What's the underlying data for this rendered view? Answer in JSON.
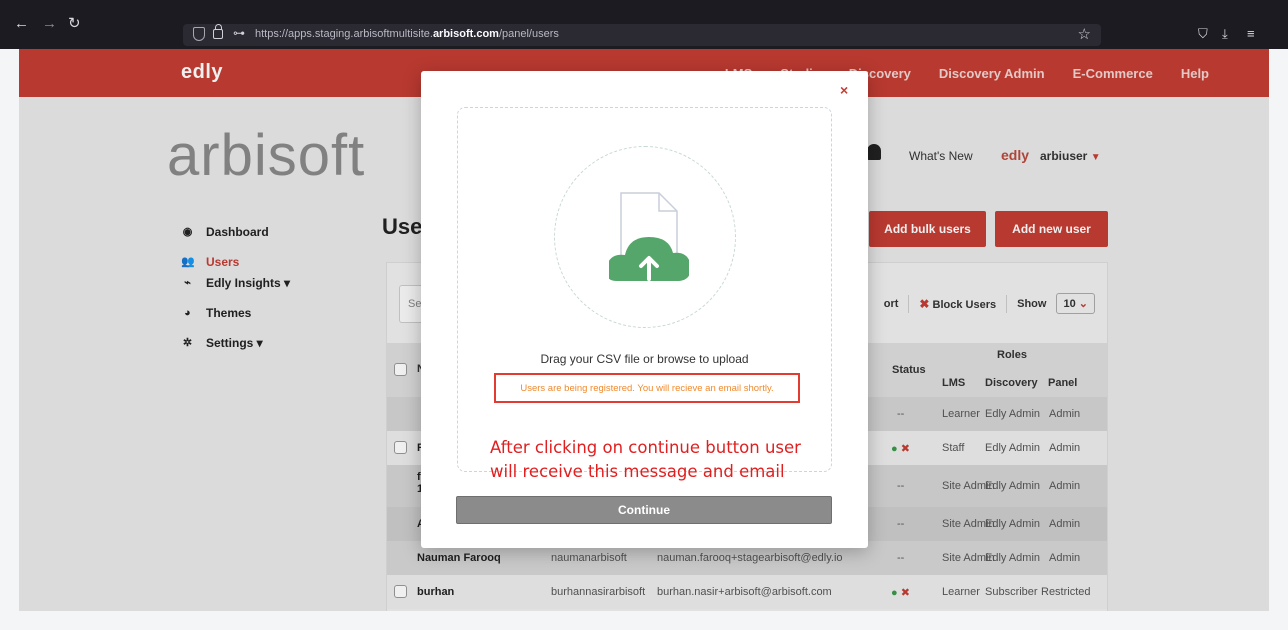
{
  "browser": {
    "back": "←",
    "forward": "→",
    "reload": "↻",
    "url_prefix": "https://apps.staging.arbisoftmultisite.",
    "url_host": "arbisoft.com",
    "url_path": "/panel/users",
    "star_icon": "star-icon",
    "pocket": "⛉",
    "download": "⤓",
    "menu": "≡"
  },
  "topnav": {
    "logo": "edly",
    "links": [
      "LMS",
      "Studio",
      "Discovery",
      "Discovery Admin",
      "E-Commerce",
      "Help"
    ]
  },
  "header": {
    "brand": "arbisoft",
    "whats_new": "What's New",
    "user_logo": "edly",
    "username": "arbiuser"
  },
  "sidebar": {
    "items": [
      {
        "label": "Dashboard",
        "icon": "dashboard-icon"
      },
      {
        "label": "Users",
        "icon": "users-icon"
      },
      {
        "label": "Edly Insights ▾",
        "icon": "chart-icon"
      },
      {
        "label": "Themes",
        "icon": "palette-icon"
      },
      {
        "label": "Settings ▾",
        "icon": "gear-icon"
      }
    ]
  },
  "main": {
    "title": "Users",
    "add_bulk": "Add bulk users",
    "add_new": "Add new user",
    "search_stub": "Se",
    "export_stub": "ort",
    "block_users": "Block Users",
    "show_label": "Show",
    "show_value": "10"
  },
  "table": {
    "name_stub": "N",
    "status": "Status",
    "roles": "Roles",
    "lms": "LMS",
    "discovery": "Discovery",
    "panel": "Panel",
    "rows": [
      {
        "name": "",
        "username": "",
        "email": "",
        "status": "--",
        "lms": "Learner",
        "discovery": "Edly Admin",
        "panel": "Admin"
      },
      {
        "name": "R",
        "username": "",
        "email": "",
        "status": "ok",
        "lms": "Staff",
        "discovery": "Edly Admin",
        "panel": "Admin"
      },
      {
        "name": "fa\n1",
        "username": "",
        "email": "",
        "status": "--",
        "lms": "Site Admin",
        "discovery": "Edly Admin",
        "panel": "Admin"
      },
      {
        "name": "A",
        "username": "",
        "email": "",
        "status": "--",
        "lms": "Site Admin",
        "discovery": "Edly Admin",
        "panel": "Admin"
      },
      {
        "name": "Nauman Farooq",
        "username": "naumanarbisoft",
        "email": "nauman.farooq+stagearbisoft@edly.io",
        "status": "--",
        "lms": "Site Admin",
        "discovery": "Edly Admin",
        "panel": "Admin"
      },
      {
        "name": "burhan",
        "username": "burhannasirarbisoft",
        "email": "burhan.nasir+arbisoft@arbisoft.com",
        "status": "ok",
        "lms": "Learner",
        "discovery": "Subscriber",
        "panel": "Restricted"
      }
    ]
  },
  "modal": {
    "close": "×",
    "drop_text": "Drag your CSV file or browse to upload",
    "message": "Users are being registered. You will recieve an email shortly.",
    "continue": "Continue"
  },
  "annotation": {
    "line1": "After clicking on continue button user",
    "line2": "will receive this message and email"
  }
}
